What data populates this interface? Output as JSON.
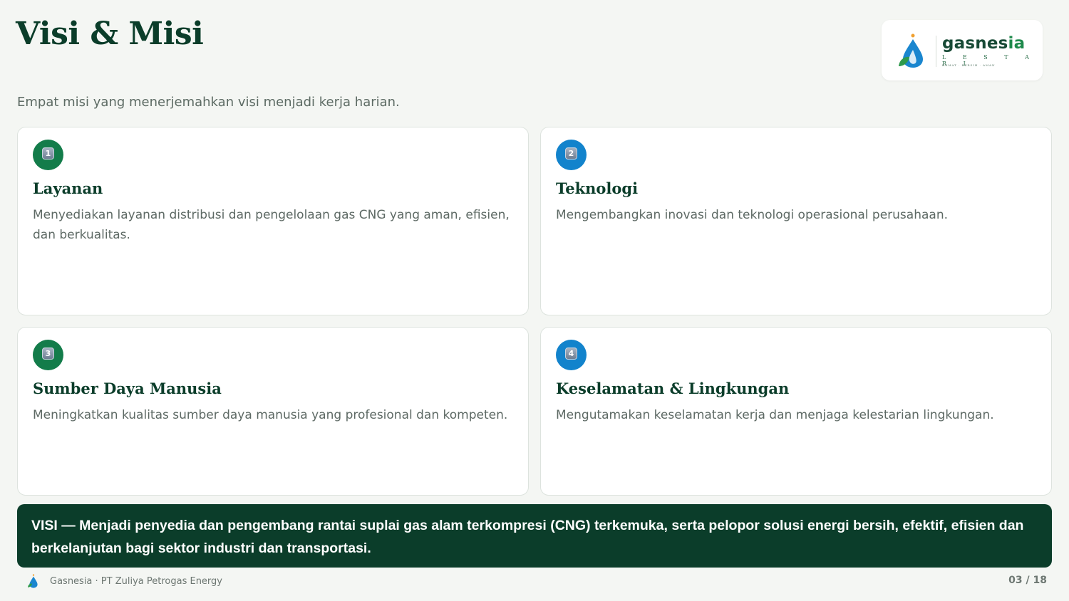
{
  "header": {
    "title": "Visi & Misi",
    "subtitle": "Empat misi yang menerjemahkan visi menjadi kerja harian."
  },
  "logo": {
    "brand_main": "gasnes",
    "brand_accent": "ia",
    "line2": "L E S T A R I",
    "tagline": "HEMAT · BERSIH · AMAN"
  },
  "missions": [
    {
      "number": "1",
      "title": "Layanan",
      "description": "Menyediakan layanan distribusi dan pengelolaan gas CNG yang aman, efisien, dan berkualitas.",
      "badge_color": "#137c4a"
    },
    {
      "number": "2",
      "title": "Teknologi",
      "description": "Mengembangkan inovasi dan teknologi operasional perusahaan.",
      "badge_color": "#1283cc"
    },
    {
      "number": "3",
      "title": "Sumber Daya Manusia",
      "description": "Meningkatkan kualitas sumber daya manusia yang profesional dan kompeten.",
      "badge_color": "#137c4a"
    },
    {
      "number": "4",
      "title": "Keselamatan & Lingkungan",
      "description": "Mengutamakan keselamatan kerja dan menjaga kelestarian lingkungan.",
      "badge_color": "#1283cc"
    }
  ],
  "vision": {
    "text": "VISI — Menjadi penyedia dan pengembang rantai suplai gas alam terkompresi (CNG) terkemuka, serta pelopor solusi energi bersih, efektif, efisien dan berkelanjutan bagi sektor industri dan transportasi."
  },
  "footer": {
    "company": "Gasnesia · PT Zuliya Petrogas Energy",
    "page": "03 / 18"
  },
  "colors": {
    "primary_dark": "#0b3d2a",
    "green": "#137c4a",
    "blue": "#1283cc",
    "background": "#f4f6f3"
  },
  "icons": {
    "logo": "gas-drop-leaf-icon",
    "badge": "keycap-number-icon"
  }
}
